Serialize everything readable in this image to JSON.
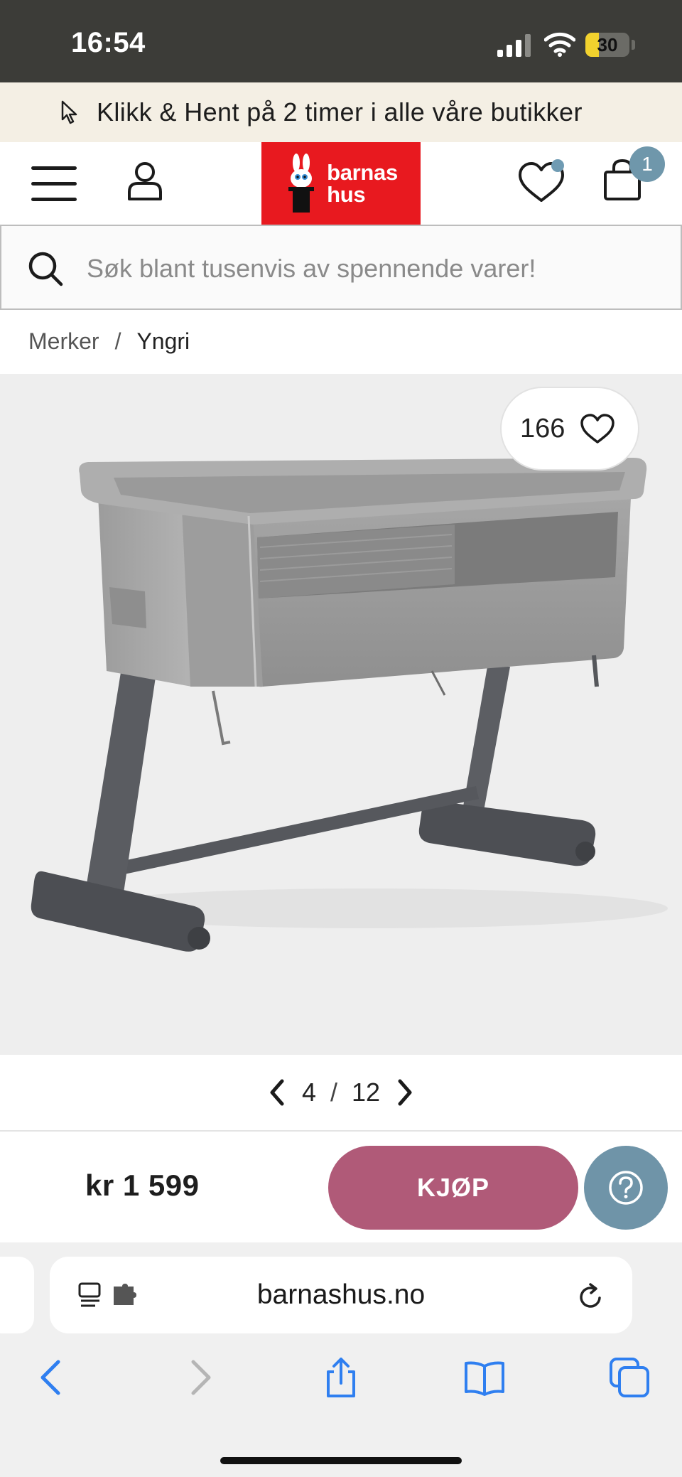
{
  "status_bar": {
    "time": "16:54",
    "battery": "30",
    "battery_level": 0.3
  },
  "promo": {
    "text": "Klikk & Hent på 2 timer i alle våre butikker"
  },
  "header": {
    "logo_line1": "barnas",
    "logo_line2": "hus",
    "cart_count": "1",
    "brand_color": "#e8191f"
  },
  "search": {
    "placeholder": "Søk blant tusenvis av spennende varer!"
  },
  "breadcrumb": {
    "items": [
      "Merker",
      "Yngri"
    ],
    "separator": "/"
  },
  "product": {
    "like_count": "166",
    "image_index": "4",
    "image_total": "12"
  },
  "buy_bar": {
    "price": "kr 1 599",
    "buy_label": "KJØP",
    "buy_color": "#b05a78",
    "help_color": "#6f94a8"
  },
  "browser": {
    "url": "barnashus.no"
  }
}
